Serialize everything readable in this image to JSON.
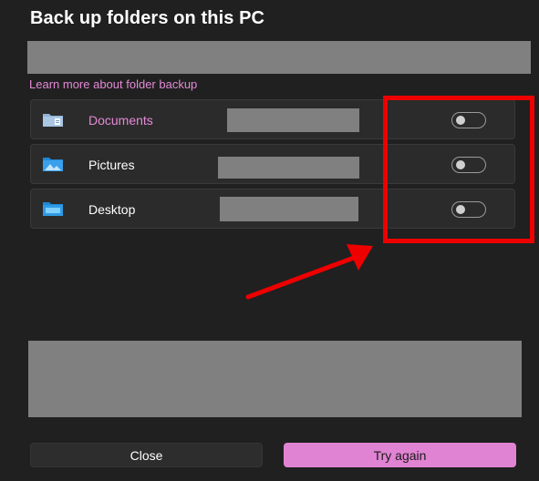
{
  "dialog": {
    "title": "Back up folders on this PC",
    "learn_more_link": "Learn more about folder backup"
  },
  "folders": [
    {
      "label": "Documents",
      "icon": "documents-folder-icon",
      "toggle_on": false
    },
    {
      "label": "Pictures",
      "icon": "pictures-folder-icon",
      "toggle_on": false
    },
    {
      "label": "Desktop",
      "icon": "desktop-folder-icon",
      "toggle_on": false
    }
  ],
  "buttons": {
    "close_label": "Close",
    "try_again_label": "Try again"
  },
  "colors": {
    "accent": "#e183d3",
    "annotation": "#ee0000",
    "redaction": "#808080"
  }
}
